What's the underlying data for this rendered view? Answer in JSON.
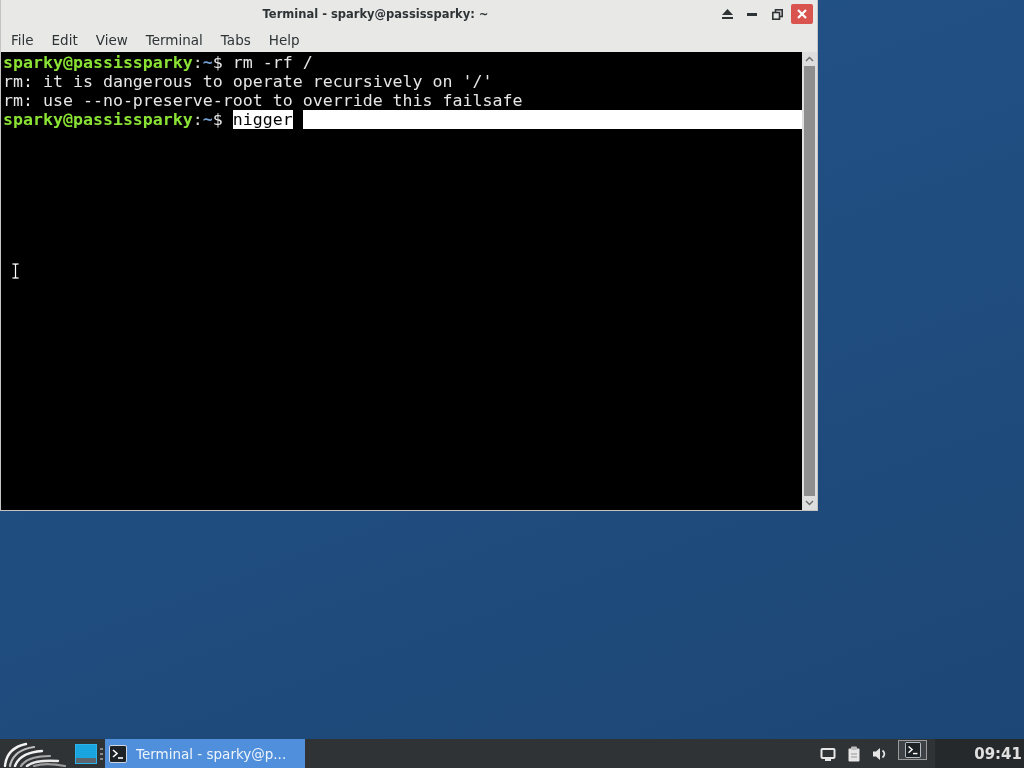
{
  "window": {
    "title": "Terminal - sparky@passissparky: ~"
  },
  "menu": [
    "File",
    "Edit",
    "View",
    "Terminal",
    "Tabs",
    "Help"
  ],
  "terminal": {
    "lines": [
      {
        "kind": "prompt",
        "user_host": "sparky@passissparky",
        "separator": ":",
        "path": "~",
        "symbol": "$",
        "command": "rm -rf /",
        "selected": false
      },
      {
        "kind": "output",
        "text": "rm: it is dangerous to operate recursively on '/'",
        "selected": false
      },
      {
        "kind": "output",
        "text": "rm: use --no-preserve-root to override this failsafe",
        "selected": false
      },
      {
        "kind": "prompt",
        "user_host": "sparky@passissparky",
        "separator": ":",
        "path": "~",
        "symbol": "$",
        "command": "nigger",
        "selected": true
      }
    ]
  },
  "taskbar": {
    "workspaces": [
      {
        "selected": true
      }
    ],
    "tasks": [
      {
        "title": "Terminal - sparky@p...",
        "selected": true
      }
    ],
    "clock": "09:41"
  }
}
